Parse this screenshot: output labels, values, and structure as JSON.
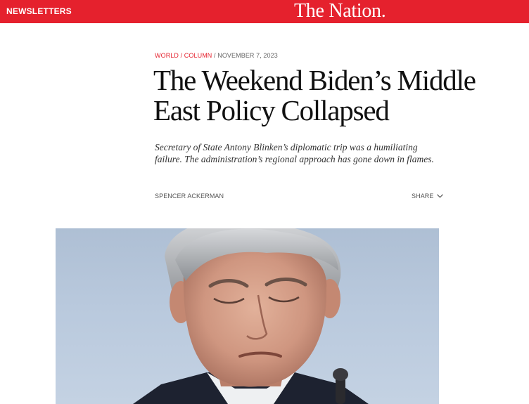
{
  "topbar": {
    "newsletters_label": "NEWSLETTERS",
    "logo_text": "The Nation.",
    "background_color": "#e5212d"
  },
  "article": {
    "section": "WORLD / COLUMN",
    "separator": " / ",
    "date": "NOVEMBER 7, 2023",
    "headline_line1": "The Weekend Biden’s Middle",
    "headline_line2": "East Policy Collapsed",
    "dek": "Secretary of State Antony Blinken’s diplomatic trip was a humiliating failure. The administration’s regional approach has gone down in flames.",
    "byline": "SPENCER ACKERMAN",
    "share_label": "SHARE",
    "share_icon": "chevron-down-icon"
  },
  "hero_image": {
    "subject": "photo"
  }
}
